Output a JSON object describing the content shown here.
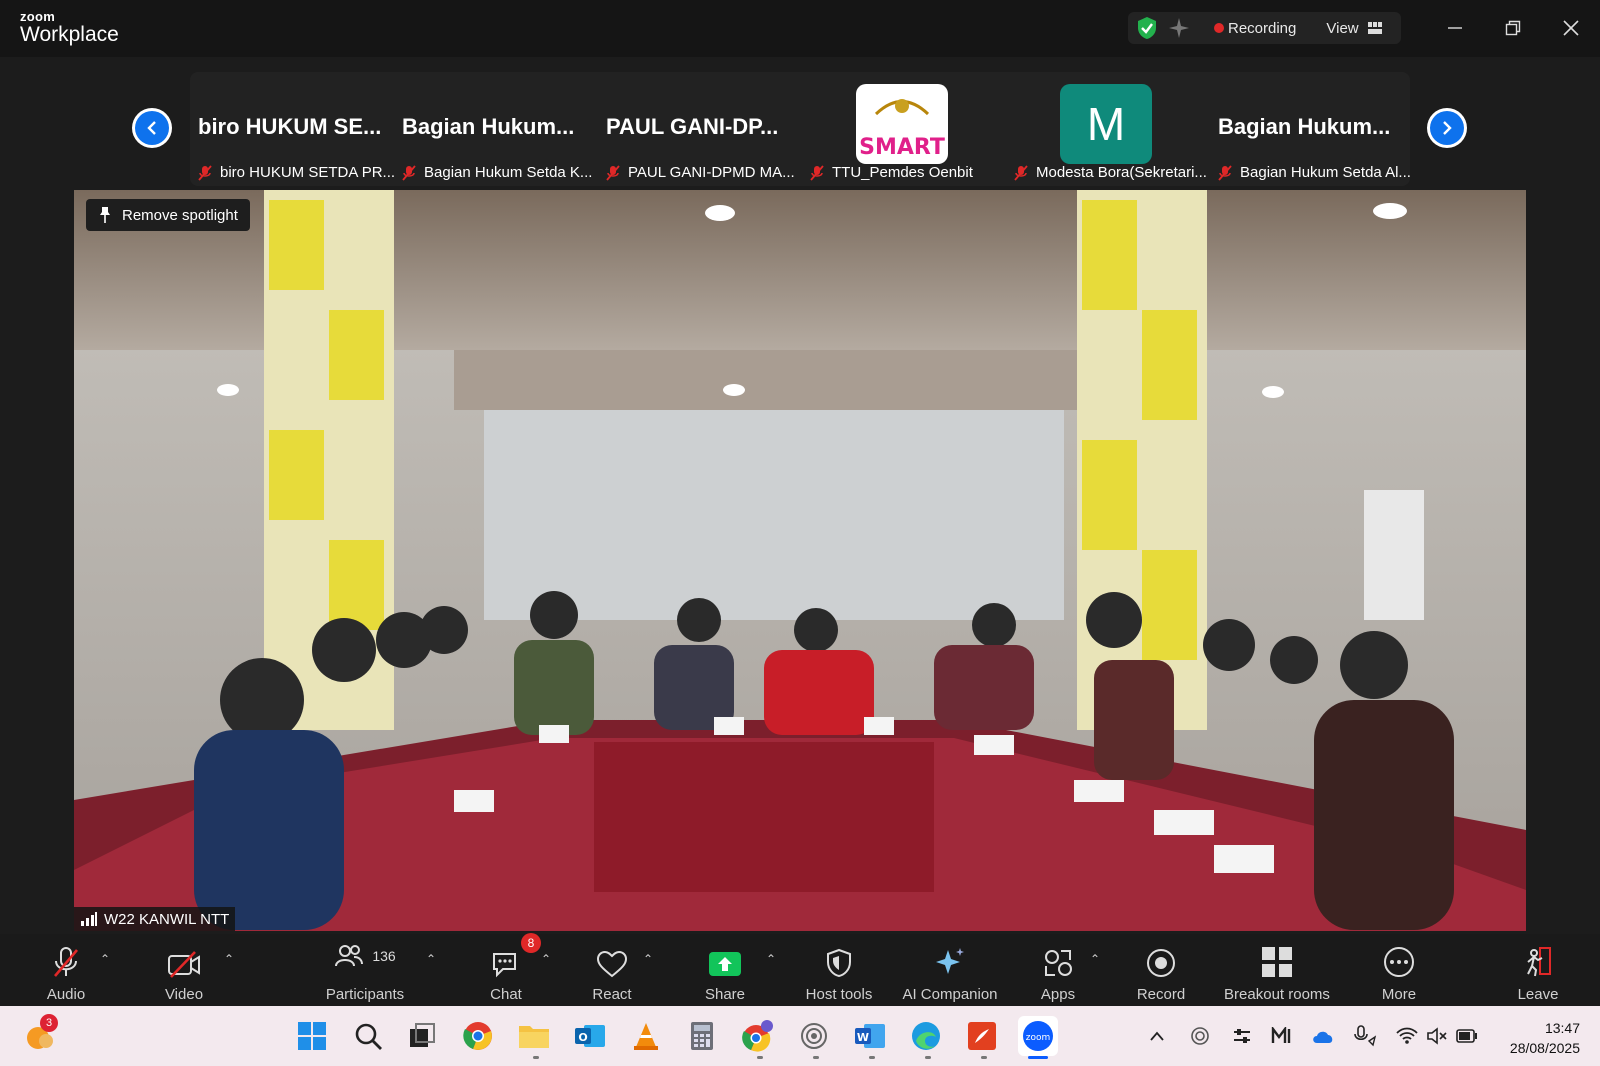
{
  "titlebar": {
    "brand_small": "zoom",
    "brand_big": "Workplace",
    "recording_label": "Recording",
    "view_label": "View"
  },
  "strip": {
    "tiles": [
      {
        "big": "biro HUKUM SE...",
        "small": "biro HUKUM SETDA PR..."
      },
      {
        "big": "Bagian  Hukum...",
        "small": "Bagian Hukum Setda K..."
      },
      {
        "big": "PAUL  GANI-DP...",
        "small": "PAUL GANI-DPMD MA..."
      },
      {
        "big": "",
        "small": "TTU_Pemdes Oenbit",
        "avatar_text": "SMART"
      },
      {
        "big": "",
        "small": "Modesta Bora(Sekretari...",
        "avatar_letter": "M"
      },
      {
        "big": "Bagian  Hukum...",
        "small": "Bagian Hukum Setda Al..."
      }
    ]
  },
  "video": {
    "spotlight_label": "Remove spotlight",
    "participant_label": "W22 KANWIL NTT"
  },
  "toolbar": {
    "audio": "Audio",
    "video": "Video",
    "participants": "Participants",
    "participants_count": "136",
    "chat": "Chat",
    "chat_badge": "8",
    "react": "React",
    "share": "Share",
    "host_tools": "Host tools",
    "ai_companion": "AI Companion",
    "apps": "Apps",
    "record": "Record",
    "breakout": "Breakout rooms",
    "more": "More",
    "leave": "Leave"
  },
  "taskbar": {
    "weather_badge": "3",
    "time": "13:47",
    "date": "28/08/2025"
  },
  "colors": {
    "accent_blue": "#0e72ed",
    "record_red": "#e02828",
    "share_green": "#12c45a",
    "avatar_teal": "#0f8a7b"
  }
}
